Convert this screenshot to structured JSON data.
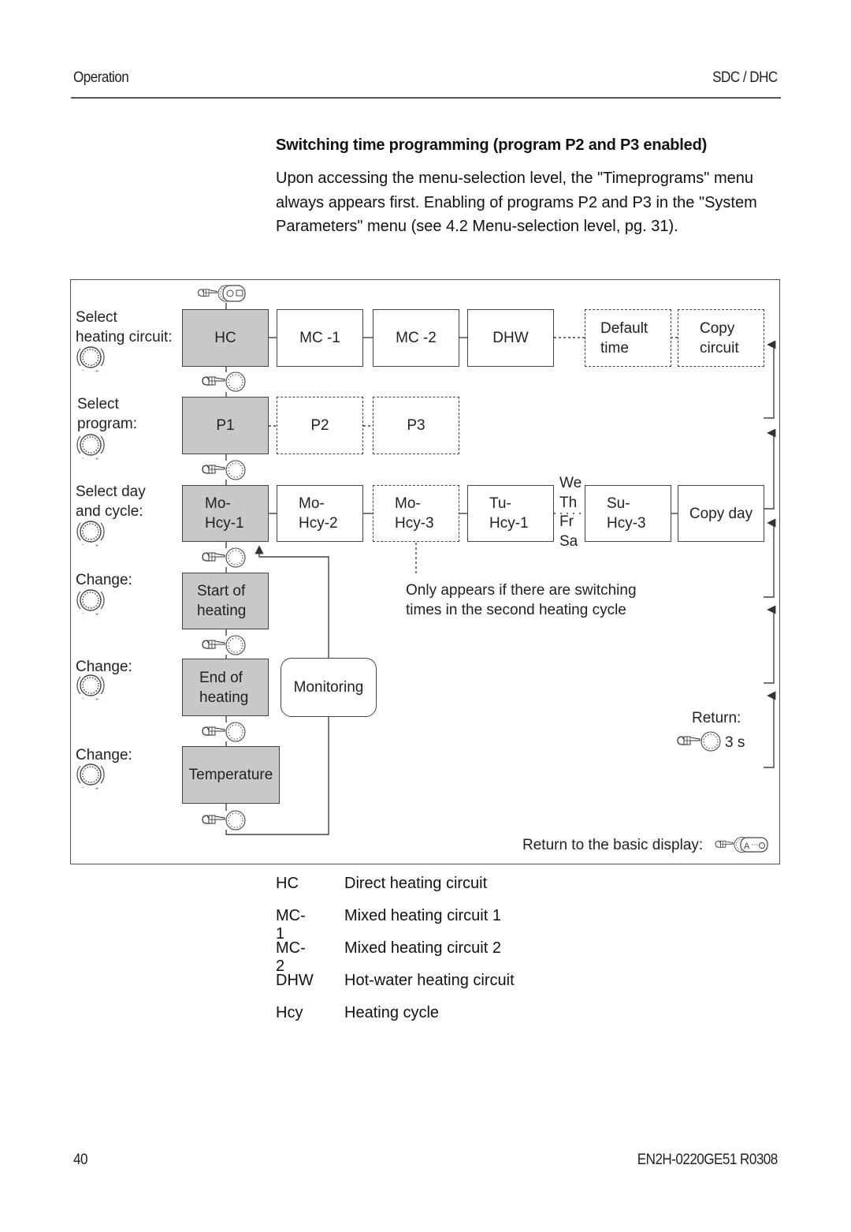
{
  "header": {
    "section": "Operation",
    "product": "SDC / DHC"
  },
  "content": {
    "title": "Switching time programming (program P2 and P3 enabled)",
    "paragraph": "Upon accessing the menu-selection level, the \"Timeprograms\" menu always appears first. Enabling of programs P2 and P3 in the \"System Parameters\" menu (see 4.2 Menu-selection level, pg. 31)."
  },
  "diagram": {
    "row_labels": {
      "select_circuit": [
        "Select",
        "heating circuit:"
      ],
      "select_program": [
        "Select",
        "program:"
      ],
      "select_day": [
        "Select day",
        "and cycle:"
      ],
      "change_start": "Change:",
      "change_end": "Change:",
      "change_temp": "Change:"
    },
    "circuits": [
      {
        "label": [
          "HC"
        ],
        "state": "selected"
      },
      {
        "label": [
          "MC -1"
        ],
        "state": "normal"
      },
      {
        "label": [
          "MC -2"
        ],
        "state": "normal"
      },
      {
        "label": [
          "DHW"
        ],
        "state": "normal"
      },
      {
        "label": [
          "Default",
          "time"
        ],
        "state": "optional"
      },
      {
        "label": [
          "Copy",
          "circuit"
        ],
        "state": "optional"
      }
    ],
    "programs": [
      {
        "label": "P1",
        "state": "selected"
      },
      {
        "label": "P2",
        "state": "optional"
      },
      {
        "label": "P3",
        "state": "optional"
      }
    ],
    "days": [
      {
        "label": [
          "Mo-",
          "Hcy-1"
        ],
        "state": "selected"
      },
      {
        "label": [
          "Mo-",
          "Hcy-2"
        ],
        "state": "normal"
      },
      {
        "label": [
          "Mo-",
          "Hcy-3"
        ],
        "state": "optional"
      },
      {
        "label": [
          "Tu-",
          "Hcy-1"
        ],
        "state": "normal"
      },
      {
        "label": [
          "Su-",
          "Hcy-3"
        ],
        "state": "normal"
      },
      {
        "label": [
          "Copy day"
        ],
        "state": "normal"
      }
    ],
    "skipped_days": [
      "We",
      "Th",
      "Fr",
      "Sa"
    ],
    "steps": {
      "start_heating": [
        "Start of",
        "heating"
      ],
      "end_heating": [
        "End of",
        "heating"
      ],
      "temperature": "Temperature",
      "monitoring": "Monitoring"
    },
    "note": [
      "Only appears if there are switching",
      "times in the second heating cycle"
    ],
    "return_label": "Return:",
    "return_time": "3 s",
    "return_basic": "Return to the basic display:"
  },
  "legend": [
    {
      "abbr": "HC",
      "meaning": "Direct heating circuit"
    },
    {
      "abbr": "MC-1",
      "meaning": "Mixed heating circuit 1"
    },
    {
      "abbr": "MC-2",
      "meaning": "Mixed heating circuit 2"
    },
    {
      "abbr": "DHW",
      "meaning": "Hot-water heating circuit"
    },
    {
      "abbr": "Hcy",
      "meaning": "Heating cycle"
    }
  ],
  "footer": {
    "page": "40",
    "doc_id": "EN2H-0220GE51 R0308"
  },
  "colors": {
    "selected_fill": "#c8c8c8",
    "line": "#444444"
  }
}
